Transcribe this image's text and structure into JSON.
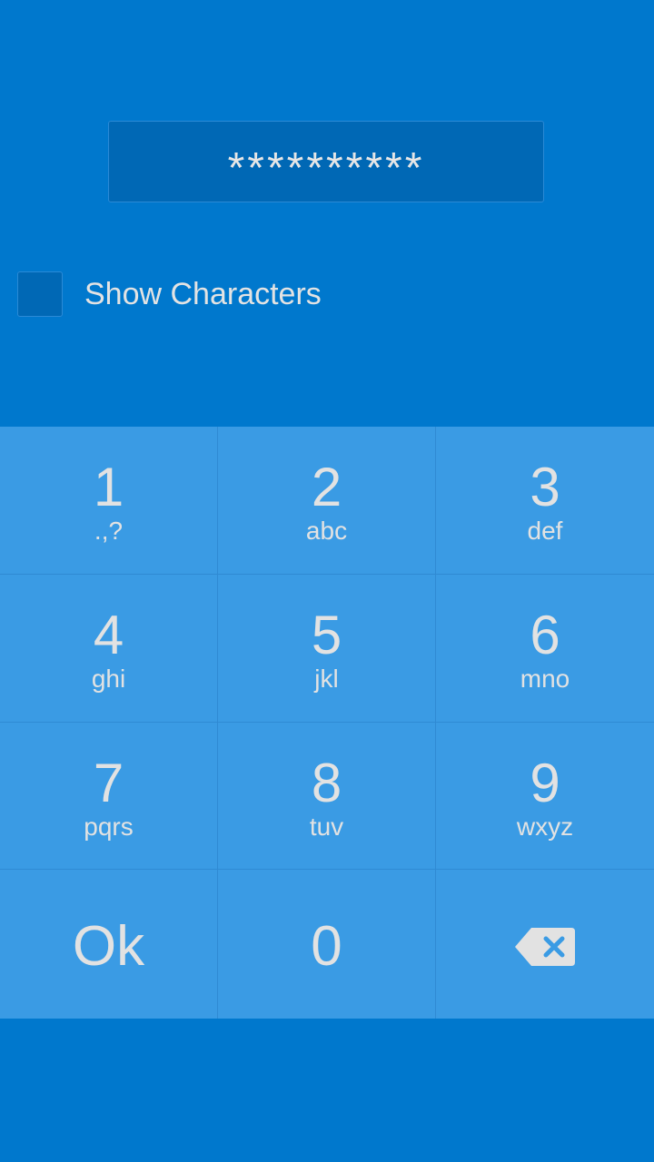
{
  "password": {
    "masked_value": "**********"
  },
  "show_characters": {
    "label": "Show Characters",
    "checked": false
  },
  "keypad": {
    "keys": [
      {
        "digit": "1",
        "letters": ".,?"
      },
      {
        "digit": "2",
        "letters": "abc"
      },
      {
        "digit": "3",
        "letters": "def"
      },
      {
        "digit": "4",
        "letters": "ghi"
      },
      {
        "digit": "5",
        "letters": "jkl"
      },
      {
        "digit": "6",
        "letters": "mno"
      },
      {
        "digit": "7",
        "letters": "pqrs"
      },
      {
        "digit": "8",
        "letters": "tuv"
      },
      {
        "digit": "9",
        "letters": "wxyz"
      }
    ],
    "ok_label": "Ok",
    "zero_label": "0",
    "backspace_icon": "backspace-icon"
  },
  "colors": {
    "background": "#0078cd",
    "key_background": "#3a9be4",
    "field_background": "#0068b5",
    "text": "#e2e2e2"
  }
}
